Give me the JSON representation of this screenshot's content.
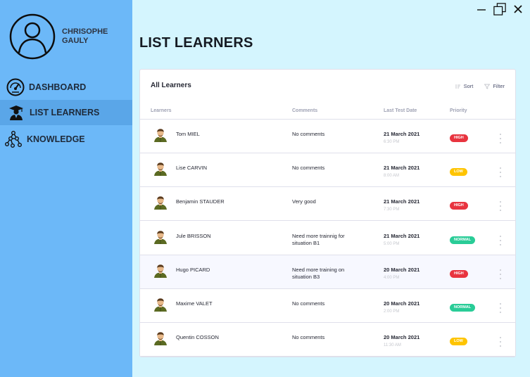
{
  "user": {
    "name": "CHRISOPHE GAULY"
  },
  "nav": [
    {
      "label": "DASHBOARD",
      "icon": "speedometer-icon",
      "active": false
    },
    {
      "label": "LIST LEARNERS",
      "icon": "graduate-icon",
      "active": true
    },
    {
      "label": "KNOWLEDGE",
      "icon": "network-icon",
      "active": false
    }
  ],
  "page": {
    "title": "LIST LEARNERS"
  },
  "card": {
    "title": "All Learners",
    "sort_label": "Sort",
    "filter_label": "Filter",
    "columns": [
      "Learners",
      "Comments",
      "Last Test Date",
      "Priority"
    ]
  },
  "colors": {
    "high": "#e8343f",
    "low": "#fec400",
    "normal": "#29cc97",
    "sidebar": "#6cb8f8",
    "background": "#d4f5fe"
  },
  "learners": [
    {
      "name": "Tom MIEL",
      "comment": "No comments",
      "date": "21 March 2021",
      "time": "6:30 PM",
      "priority": "HIGH"
    },
    {
      "name": "Lise CARVIN",
      "comment": "No comments",
      "date": "21 March 2021",
      "time": "8:00 AM",
      "priority": "LOW"
    },
    {
      "name": "Benjamin STAUDER",
      "comment": "Very good",
      "date": "21 March 2021",
      "time": "7:30 PM",
      "priority": "HIGH"
    },
    {
      "name": "Jule BRISSON",
      "comment": "Need more trainnig for situation B1",
      "date": "21 March 2021",
      "time": "5:00 PM",
      "priority": "NORMAL"
    },
    {
      "name": "Hugo PICARD",
      "comment": "Need more training on situation B3",
      "date": "20 March 2021",
      "time": "4:00 PM",
      "priority": "HIGH"
    },
    {
      "name": "Maxime VALET",
      "comment": "No comments",
      "date": "20 March 2021",
      "time": "2:00 PM",
      "priority": "NORMAL"
    },
    {
      "name": "Quentin COSSON",
      "comment": "No comments",
      "date": "20 March 2021",
      "time": "11:30 AM",
      "priority": "LOW"
    }
  ]
}
